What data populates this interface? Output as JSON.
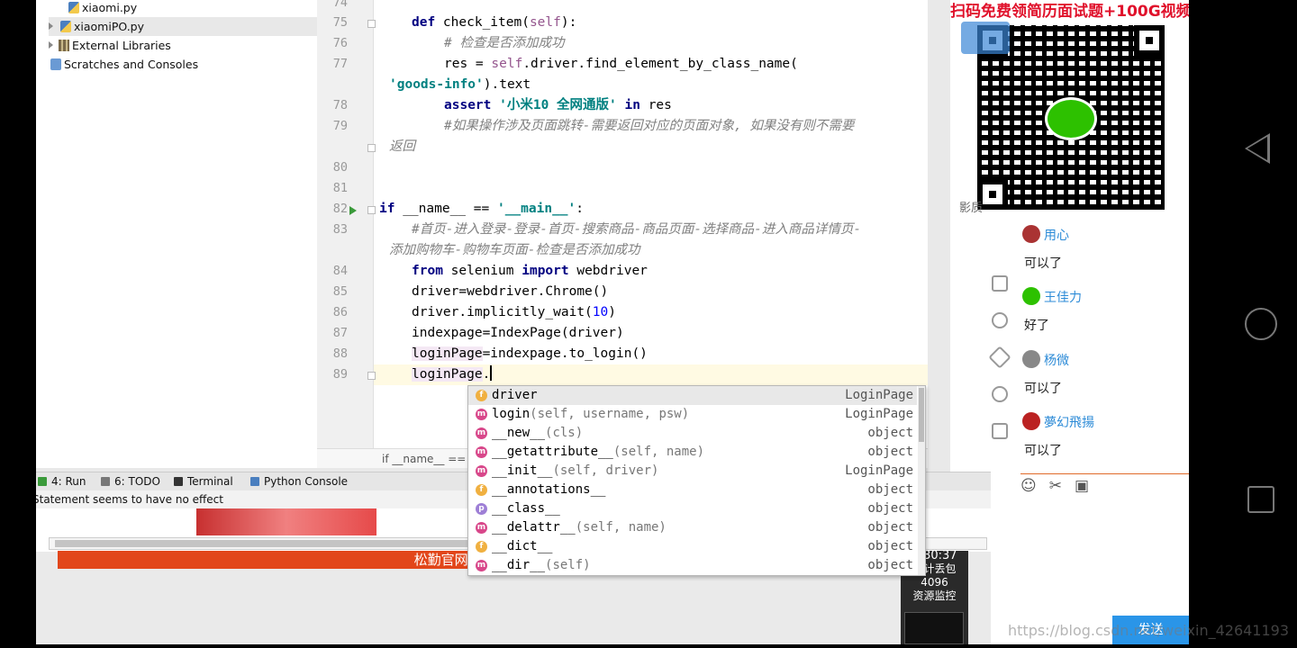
{
  "project_tree": {
    "items": [
      {
        "label": "xiaomi.py",
        "type": "file"
      },
      {
        "label": "xiaomiPO.py",
        "type": "file"
      },
      {
        "label": "External Libraries",
        "type": "library"
      },
      {
        "label": "Scratches and Consoles",
        "type": "scratches"
      }
    ]
  },
  "editor": {
    "line_numbers": [
      "74",
      "75",
      "76",
      "77",
      "78",
      "79",
      "80",
      "81",
      "82",
      "83",
      "84",
      "85",
      "86",
      "87",
      "88",
      "89"
    ],
    "lines": {
      "l75_kw": "def ",
      "l75_rest": "check_item(",
      "l75_self": "self",
      "l75_end": "):",
      "l76": "# 检查是否添加成功",
      "l77_a": "res = ",
      "l77_self": "self",
      "l77_b": ".driver.find_element_by_class_name(",
      "l77_wrap": "'goods-info'",
      "l77_wrap_end": ").text",
      "l78_kw": "assert ",
      "l78_str": "'小米10 全网通版'",
      "l78_kw2": " in ",
      "l78_end": "res",
      "l79": "#如果操作涉及页面跳转-需要返回对应的页面对象, 如果没有则不需要",
      "l79_wrap": "返回",
      "l82_kw": "if ",
      "l82_a": "__name__ == ",
      "l82_str": "'__main__'",
      "l82_end": ":",
      "l83": "#首页-进入登录-登录-首页-搜索商品-商品页面-选择商品-进入商品详情页-",
      "l83_wrap": "添加购物车-购物车页面-检查是否添加成功",
      "l84_kw": "from ",
      "l84_a": "selenium ",
      "l84_kw2": "import ",
      "l84_b": "webdriver",
      "l85": "driver=webdriver.Chrome()",
      "l86_a": "driver.implicitly_wait(",
      "l86_num": "10",
      "l86_end": ")",
      "l87": "indexpage=IndexPage(driver)",
      "l88_a": "loginPage",
      "l88_b": "=indexpage.to_login()",
      "l89_a": "loginPage",
      "l89_b": "."
    },
    "breadcrumb": "if __name__ == '_"
  },
  "autocomplete": {
    "items": [
      {
        "badge": "f",
        "name": "driver",
        "sig": "",
        "type": "LoginPage"
      },
      {
        "badge": "m",
        "name": "login",
        "sig": "(self, username, psw)",
        "type": "LoginPage"
      },
      {
        "badge": "m",
        "name": "__new__",
        "sig": "(cls)",
        "type": "object"
      },
      {
        "badge": "m",
        "name": "__getattribute__",
        "sig": "(self, name)",
        "type": "object"
      },
      {
        "badge": "m",
        "name": "__init__",
        "sig": "(self, driver)",
        "type": "LoginPage"
      },
      {
        "badge": "f",
        "name": "__annotations__",
        "sig": "",
        "type": "object"
      },
      {
        "badge": "p",
        "name": "__class__",
        "sig": "",
        "type": "object"
      },
      {
        "badge": "m",
        "name": "__delattr__",
        "sig": "(self, name)",
        "type": "object"
      },
      {
        "badge": "f",
        "name": "__dict__",
        "sig": "",
        "type": "object"
      },
      {
        "badge": "m",
        "name": "__dir__",
        "sig": "(self)",
        "type": "object"
      }
    ]
  },
  "tool_windows": {
    "run": "4: Run",
    "todo": "6: TODO",
    "terminal": "Terminal",
    "python_console": "Python Console"
  },
  "status": {
    "message": "Statement seems to have no effect"
  },
  "video_overlay": {
    "banner": "松勤官网: ww"
  },
  "chat_panel": {
    "qr_title": "扫码免费领简历面试题+100G视频",
    "side_label": "影质",
    "messages": [
      {
        "user": "用心",
        "text": "可以了"
      },
      {
        "user": "王佳力",
        "text": "好了"
      },
      {
        "user": "杨微",
        "text": "可以了"
      },
      {
        "user": "夢幻飛揚",
        "text": "可以了"
      }
    ],
    "send_label": "发送",
    "time": "3:30:37",
    "monitor": {
      "label1": "累计丢包",
      "value": "4096",
      "label2": "资源监控"
    }
  },
  "watermark": "https://blog.csdn.net/weixin_42641193"
}
